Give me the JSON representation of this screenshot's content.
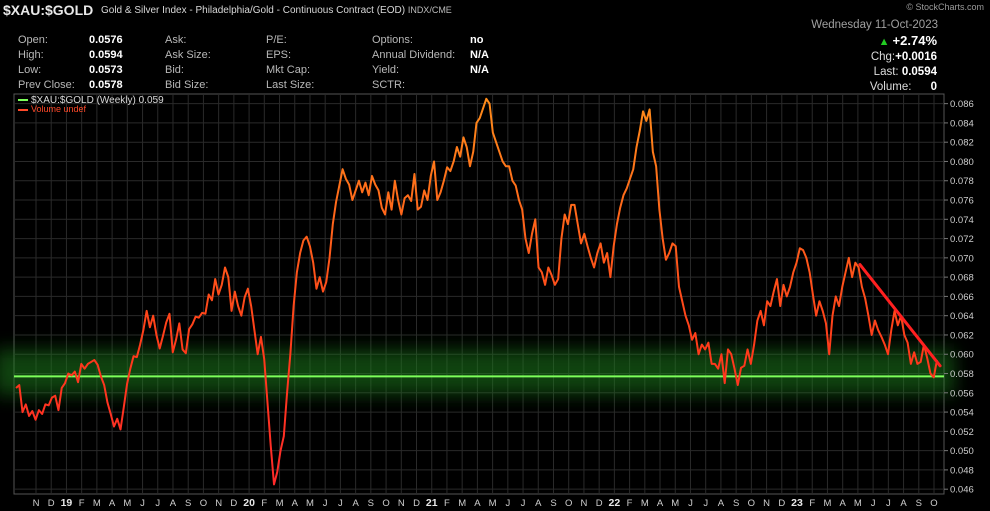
{
  "header": {
    "symbol": "$XAU:$GOLD",
    "description": "Gold & Silver Index - Philadelphia/Gold - Continuous Contract (EOD)",
    "exchange": "INDX/CME",
    "brand": "© StockCharts.com",
    "date": "Wednesday  11-Oct-2023",
    "change_pct": "+2.74%",
    "chg_label": "Chg:",
    "chg_value": "+0.0016",
    "last_label": "Last:",
    "last_value": "0.0594",
    "volume_label": "Volume:",
    "volume_value": "0"
  },
  "stats": {
    "col1": [
      {
        "label": "Open:",
        "value": "0.0576"
      },
      {
        "label": "High:",
        "value": "0.0594"
      },
      {
        "label": "Low:",
        "value": "0.0573"
      },
      {
        "label": "Prev Close:",
        "value": "0.0578"
      }
    ],
    "col2": [
      "Ask:",
      "Ask Size:",
      "Bid:",
      "Bid Size:"
    ],
    "col3": [
      "P/E:",
      "EPS:",
      "Mkt Cap:",
      "Last Size:"
    ],
    "col4": [
      {
        "label": "Options:",
        "value": "no"
      },
      {
        "label": "Annual Dividend:",
        "value": "N/A"
      },
      {
        "label": "Yield:",
        "value": "N/A"
      },
      {
        "label": "SCTR:",
        "value": ""
      }
    ]
  },
  "colors": {
    "background": "#000000",
    "grid": "#2a2a2a",
    "price_low": "#ff2a2a",
    "price_high": "#ff8c1a",
    "support_line": "#7cff5a",
    "support_band": "#1f7a1f",
    "trendline": "#ff2020",
    "legend_volume": "#ff4a2a",
    "up_triangle": "#22cc22"
  },
  "chart_data": {
    "type": "line",
    "legend": [
      {
        "text": "$XAU:$GOLD (Weekly) 0.059",
        "color": "#7cff5a"
      },
      {
        "text": "Volume undef",
        "color": "#ff4a2a"
      }
    ],
    "ylim": [
      0.0455,
      0.087
    ],
    "y_ticks": [
      "0.086",
      "0.084",
      "0.082",
      "0.080",
      "0.078",
      "0.076",
      "0.074",
      "0.072",
      "0.070",
      "0.068",
      "0.066",
      "0.064",
      "0.062",
      "0.060",
      "0.058",
      "0.056",
      "0.054",
      "0.052",
      "0.050",
      "0.048",
      "0.046"
    ],
    "x_ticks": [
      "N",
      "D",
      "19",
      "F",
      "M",
      "A",
      "M",
      "J",
      "J",
      "A",
      "S",
      "O",
      "N",
      "D",
      "20",
      "F",
      "M",
      "A",
      "M",
      "J",
      "J",
      "A",
      "S",
      "O",
      "N",
      "D",
      "21",
      "F",
      "M",
      "A",
      "M",
      "J",
      "J",
      "A",
      "S",
      "O",
      "N",
      "D",
      "22",
      "F",
      "M",
      "A",
      "M",
      "J",
      "J",
      "A",
      "S",
      "O",
      "N",
      "D",
      "23",
      "F",
      "M",
      "A",
      "M",
      "J",
      "J",
      "A",
      "S",
      "O"
    ],
    "x_start": "2018-11",
    "series": [
      {
        "name": "$XAU:$GOLD (Weekly)",
        "frequency": "weekly",
        "values": [
          0.0565,
          0.0568,
          0.054,
          0.0548,
          0.0536,
          0.0541,
          0.0532,
          0.0542,
          0.0538,
          0.0548,
          0.0547,
          0.0555,
          0.0557,
          0.0542,
          0.0565,
          0.057,
          0.058,
          0.0578,
          0.0582,
          0.0571,
          0.059,
          0.0585,
          0.059,
          0.0592,
          0.0594,
          0.0589,
          0.0577,
          0.0568,
          0.055,
          0.0538,
          0.0525,
          0.0533,
          0.0522,
          0.0545,
          0.0569,
          0.0585,
          0.0598,
          0.0597,
          0.061,
          0.0625,
          0.0645,
          0.0628,
          0.064,
          0.062,
          0.0606,
          0.0619,
          0.0633,
          0.0642,
          0.0602,
          0.0615,
          0.0632,
          0.0605,
          0.0601,
          0.0626,
          0.0631,
          0.0639,
          0.0638,
          0.0643,
          0.0642,
          0.0662,
          0.0656,
          0.0678,
          0.0662,
          0.0672,
          0.069,
          0.068,
          0.0645,
          0.0665,
          0.065,
          0.064,
          0.0659,
          0.0668,
          0.065,
          0.0625,
          0.06,
          0.0618,
          0.0595,
          0.055,
          0.0505,
          0.0465,
          0.0478,
          0.05,
          0.0515,
          0.056,
          0.06,
          0.065,
          0.0685,
          0.0705,
          0.0718,
          0.0722,
          0.0712,
          0.0695,
          0.0668,
          0.068,
          0.0665,
          0.0675,
          0.07,
          0.0735,
          0.0758,
          0.0775,
          0.0792,
          0.0782,
          0.0776,
          0.076,
          0.077,
          0.078,
          0.0768,
          0.0778,
          0.0765,
          0.0785,
          0.0776,
          0.077,
          0.0752,
          0.0745,
          0.0768,
          0.075,
          0.078,
          0.076,
          0.0745,
          0.0762,
          0.0765,
          0.0759,
          0.0787,
          0.075,
          0.0753,
          0.077,
          0.076,
          0.0785,
          0.08,
          0.076,
          0.0768,
          0.078,
          0.0794,
          0.079,
          0.08,
          0.0815,
          0.0805,
          0.0825,
          0.0815,
          0.0795,
          0.081,
          0.084,
          0.0845,
          0.0855,
          0.0865,
          0.086,
          0.083,
          0.082,
          0.081,
          0.08,
          0.0795,
          0.0795,
          0.078,
          0.0775,
          0.076,
          0.075,
          0.072,
          0.0705,
          0.0725,
          0.074,
          0.069,
          0.0685,
          0.0672,
          0.069,
          0.0682,
          0.0672,
          0.0678,
          0.072,
          0.0745,
          0.0735,
          0.0755,
          0.0755,
          0.0735,
          0.0715,
          0.0725,
          0.0712,
          0.07,
          0.069,
          0.0705,
          0.0715,
          0.0695,
          0.0705,
          0.068,
          0.0712,
          0.0735,
          0.0752,
          0.0765,
          0.0772,
          0.0782,
          0.0792,
          0.0815,
          0.0832,
          0.0852,
          0.0842,
          0.0854,
          0.081,
          0.0795,
          0.075,
          0.072,
          0.0698,
          0.0705,
          0.0715,
          0.0712,
          0.067,
          0.0655,
          0.064,
          0.063,
          0.0615,
          0.0622,
          0.06,
          0.061,
          0.0605,
          0.0612,
          0.059,
          0.059,
          0.0585,
          0.06,
          0.057,
          0.0605,
          0.06,
          0.0585,
          0.0568,
          0.0586,
          0.0588,
          0.0605,
          0.059,
          0.061,
          0.0635,
          0.0645,
          0.063,
          0.0655,
          0.065,
          0.0665,
          0.0678,
          0.065,
          0.0672,
          0.066,
          0.067,
          0.0685,
          0.0695,
          0.071,
          0.0708,
          0.07,
          0.0685,
          0.0662,
          0.064,
          0.0655,
          0.0645,
          0.0632,
          0.06,
          0.064,
          0.066,
          0.065,
          0.067,
          0.0685,
          0.07,
          0.068,
          0.0695,
          0.069,
          0.067,
          0.0658,
          0.064,
          0.062,
          0.0635,
          0.0625,
          0.0618,
          0.061,
          0.06,
          0.0625,
          0.0645,
          0.063,
          0.064,
          0.062,
          0.0612,
          0.059,
          0.0602,
          0.059,
          0.0592,
          0.061,
          0.0596,
          0.058,
          0.0576,
          0.0594
        ]
      }
    ],
    "support_level": 0.0577,
    "support_band": [
      0.0558,
      0.0605
    ],
    "trendline": {
      "from": {
        "date": "2023-05-05",
        "value": 0.0693
      },
      "to": {
        "date": "2023-10-13",
        "value": 0.0588
      }
    },
    "grid": true,
    "legend_position": "top-left",
    "axis_position": "right"
  }
}
